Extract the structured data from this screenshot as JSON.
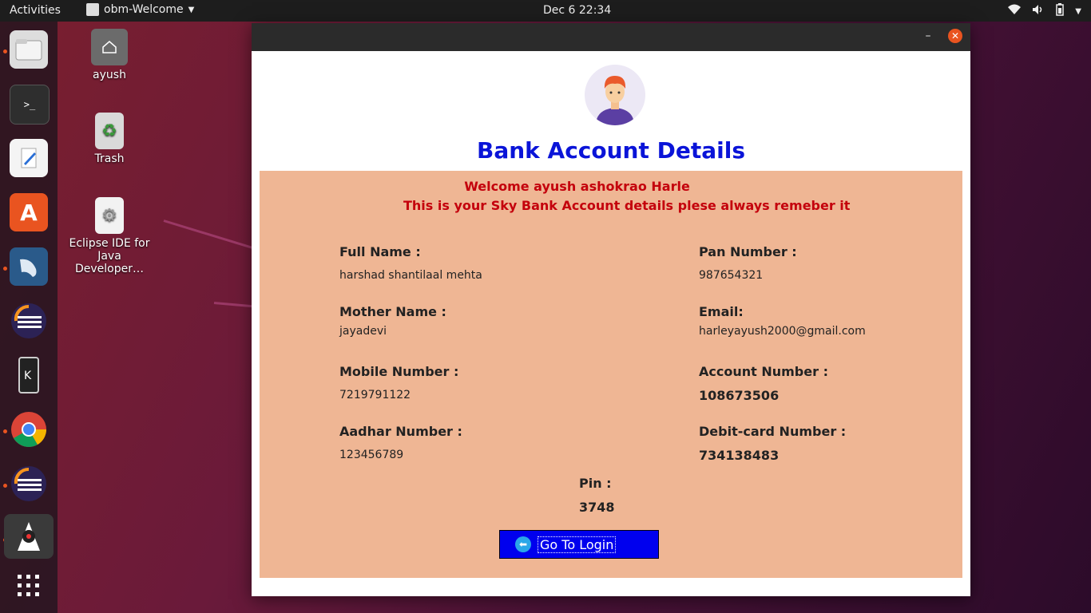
{
  "topbar": {
    "activities": "Activities",
    "app_name": "obm-Welcome",
    "clock": "Dec 6  22:34"
  },
  "desktop": {
    "icons": [
      {
        "label": "ayush"
      },
      {
        "label": "Trash"
      },
      {
        "label": "Eclipse IDE for Java Developer…"
      }
    ]
  },
  "window": {
    "heading": "Bank Account Details",
    "welcome_line1": "Welcome ayush ashokrao Harle",
    "welcome_line2": "This is your Sky Bank Account details plese always remeber it",
    "fields": {
      "full_name_label": "Full Name :",
      "full_name_value": "harshad shantilaal mehta",
      "pan_label": "Pan Number :",
      "pan_value": "987654321",
      "mother_label": "Mother Name :",
      "mother_value": "jayadevi",
      "email_label": "Email:",
      "email_value": "harleyayush2000@gmail.com",
      "mobile_label": "Mobile Number :",
      "mobile_value": "7219791122",
      "account_label": "Account Number :",
      "account_value": "108673506",
      "aadhar_label": "Aadhar Number :",
      "aadhar_value": "123456789",
      "debit_label": "Debit-card Number :",
      "debit_value": "734138483",
      "pin_label": "Pin :",
      "pin_value": "3748"
    },
    "login_button": "Go To Login"
  },
  "colors": {
    "heading": "#0a14d8",
    "welcome": "#c4000c",
    "panel": "#efb694",
    "button": "#0000ee"
  }
}
